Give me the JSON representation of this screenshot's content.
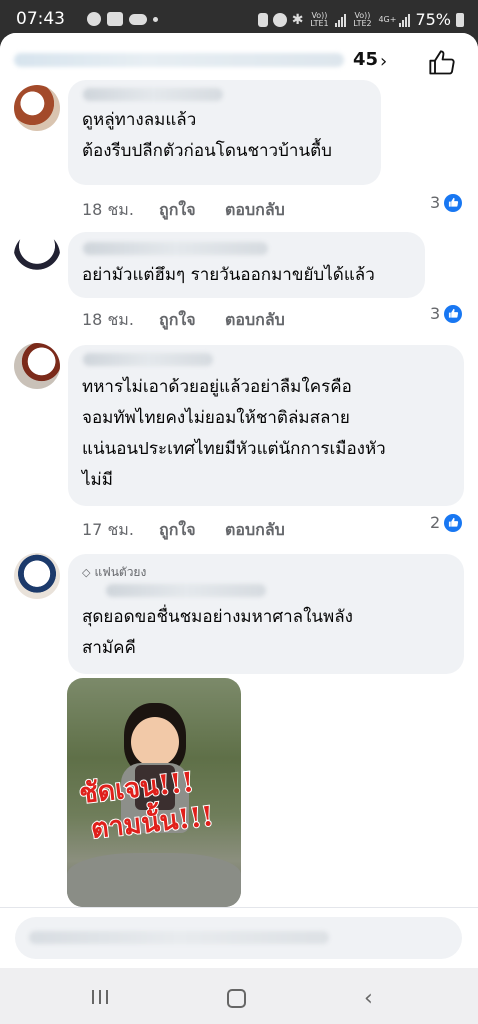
{
  "status_bar": {
    "time": "07:43",
    "net1": "Vo)) LTE1",
    "net2": "Vo)) LTE2",
    "net_type": "4G+",
    "battery": "75%"
  },
  "header": {
    "reaction_count": "45",
    "chevron": "›"
  },
  "comments": [
    {
      "lines": [
        "ดูหลู่ทางลมแล้ว",
        "ต้องรีบปลีกตัวก่อนโดนชาวบ้านตื้บ"
      ],
      "time": "18 ชม.",
      "like": "ถูกใจ",
      "reply": "ตอบกลับ",
      "reactions": "3"
    },
    {
      "lines": [
        "อย่ามัวแต่ฮึมๆ รายวันออกมาขยับได้แล้ว"
      ],
      "time": "18 ชม.",
      "like": "ถูกใจ",
      "reply": "ตอบกลับ",
      "reactions": "3"
    },
    {
      "lines": [
        "ทหารไม่เอาด้วยอยู่แล้วอย่าลืมใครคือ",
        "จอมทัพไทยคงไม่ยอมให้ชาติล่มสลาย",
        "แน่นอนประเทศไทยมีหัวแต่นักการเมืองหัว",
        "ไม่มี"
      ],
      "time": "17 ชม.",
      "like": "ถูกใจ",
      "reply": "ตอบกลับ",
      "reactions": "2"
    },
    {
      "badge": "แฟนตัวยง",
      "lines": [
        "สุดยอดขอชื่นชมอย่างมหาศาลในพลัง",
        "สามัคคี"
      ],
      "image_text": [
        "ชัดเจน!!!",
        "ตามนั้น!!!"
      ]
    }
  ],
  "colors": {
    "accent": "#1877f2",
    "bubble": "#f0f2f5",
    "meta_text": "#65676b"
  }
}
